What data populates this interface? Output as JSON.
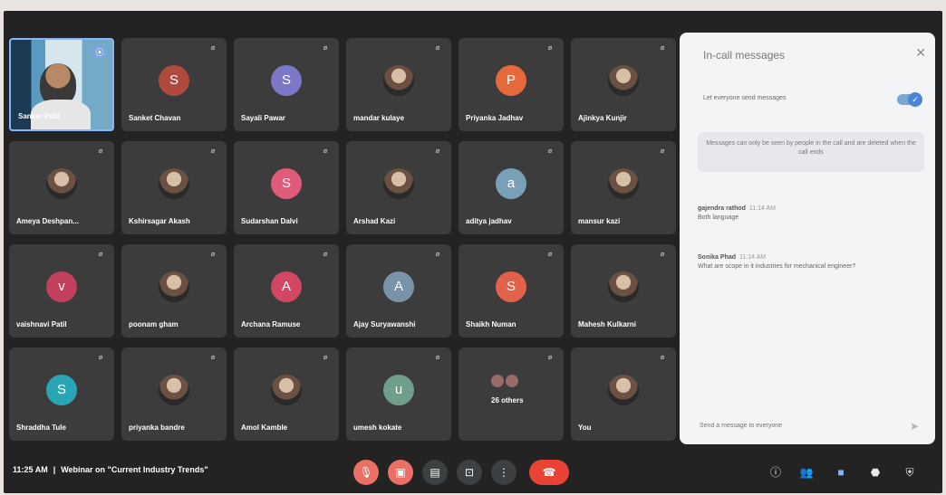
{
  "self": {
    "name": "Sanket Patil"
  },
  "tiles": [
    {
      "name": "Sanket Chavan",
      "type": "letter",
      "letter": "S",
      "color": "#b04a3c"
    },
    {
      "name": "Sayali Pawar",
      "type": "letter",
      "letter": "S",
      "color": "#7b78c7"
    },
    {
      "name": "mandar kulaye",
      "type": "photo"
    },
    {
      "name": "Priyanka Jadhav",
      "type": "letter",
      "letter": "P",
      "color": "#e6693b"
    },
    {
      "name": "Ajinkya Kunjir",
      "type": "photo"
    },
    {
      "name": "Ameya Deshpan...",
      "type": "photo"
    },
    {
      "name": "Kshirsagar Akash",
      "type": "photo"
    },
    {
      "name": "Sudarshan Dalvi",
      "type": "letter",
      "letter": "S",
      "color": "#e05a7a"
    },
    {
      "name": "Arshad Kazi",
      "type": "photo"
    },
    {
      "name": "aditya jadhav",
      "type": "letter",
      "letter": "a",
      "color": "#7aa0b8"
    },
    {
      "name": "mansur kazi",
      "type": "photo"
    },
    {
      "name": "vaishnavi Patil",
      "type": "letter",
      "letter": "v",
      "color": "#c2405e"
    },
    {
      "name": "poonam gham",
      "type": "photo"
    },
    {
      "name": "Archana Ramuse",
      "type": "letter",
      "letter": "A",
      "color": "#d24862"
    },
    {
      "name": "Ajay Suryawanshi",
      "type": "letter",
      "letter": "A",
      "color": "#7a93a8"
    },
    {
      "name": "Shaikh Numan",
      "type": "letter",
      "letter": "S",
      "color": "#e1614a"
    },
    {
      "name": "Mahesh Kulkarni",
      "type": "photo"
    },
    {
      "name": "Shraddha Tule",
      "type": "letter",
      "letter": "S",
      "color": "#2aa5b3"
    },
    {
      "name": "priyanka bandre",
      "type": "photo"
    },
    {
      "name": "Amol Kamble",
      "type": "photo"
    },
    {
      "name": "umesh kokate",
      "type": "letter",
      "letter": "u",
      "color": "#6f9e8a"
    },
    {
      "name": "26 others",
      "type": "others"
    },
    {
      "name": "You",
      "type": "photo"
    }
  ],
  "bottombar": {
    "time": "11:25 AM",
    "separator": "|",
    "title": "Webinar on \"Current Industry Trends\""
  },
  "panel": {
    "title": "In-call messages",
    "toggle_label": "Let everyone send messages",
    "toggle_on": true,
    "notice": "Messages can only be seen by people in the call and are deleted when the call ends",
    "messages": [
      {
        "author": "gajendra rathod",
        "time": "11:14 AM",
        "text": "Both language"
      },
      {
        "author": "Sonika Phad",
        "time": "11:14 AM",
        "text": "What are scope in it industries for mechanical engineer?"
      }
    ],
    "compose_placeholder": "Send a message to everyone"
  },
  "icons": {
    "close": "close-icon",
    "send": "send-icon",
    "mic": "mic-off-icon",
    "info": "info-icon",
    "people": "people-icon",
    "chat": "chat-icon",
    "activities": "activities-icon",
    "shield": "shield-icon"
  },
  "colors": {
    "accent": "#8ab4f8",
    "danger": "#ea4335",
    "panel_bg": "#f3f4f6"
  }
}
